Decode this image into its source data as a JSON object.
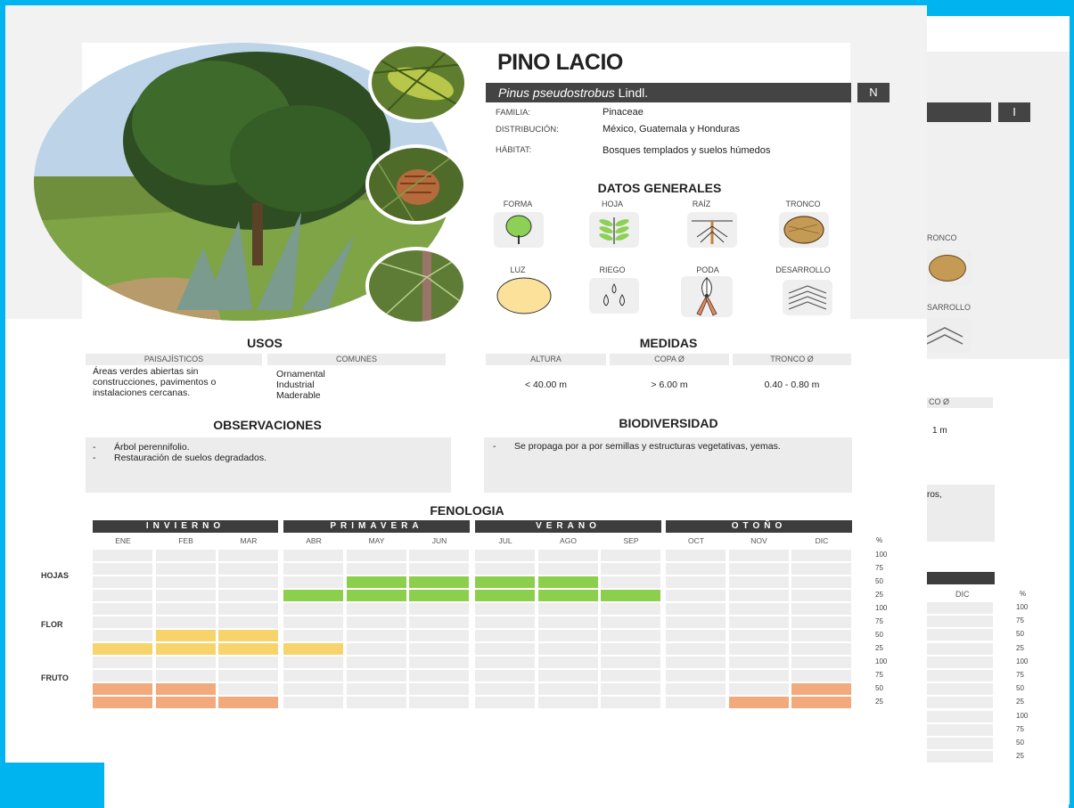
{
  "species": {
    "common_name": "PINO LACIO",
    "scientific_name": "Pinus pseudostrobus",
    "author": "Lindl.",
    "tag": "N",
    "back_tag": "I"
  },
  "info": [
    {
      "label": "FAMILIA:",
      "value": "Pinaceae"
    },
    {
      "label": "DISTRIBUCIÓN:",
      "value": "México, Guatemala y Honduras"
    },
    {
      "label": "HÁBITAT:",
      "value": "Bosques templados y suelos húmedos"
    }
  ],
  "datos_generales": {
    "title": "DATOS GENERALES",
    "items": [
      {
        "label": "FORMA",
        "icon": "tree-shape-icon"
      },
      {
        "label": "HOJA",
        "icon": "leaf-branch-icon"
      },
      {
        "label": "RAÍZ",
        "icon": "root-icon"
      },
      {
        "label": "TRONCO",
        "icon": "trunk-section-icon"
      },
      {
        "label": "LUZ",
        "icon": "light-icon"
      },
      {
        "label": "RIEGO",
        "icon": "water-drops-icon"
      },
      {
        "label": "PODA",
        "icon": "pruning-shears-icon"
      },
      {
        "label": "DESARROLLO",
        "icon": "growth-chevrons-icon"
      }
    ]
  },
  "usos": {
    "title": "USOS",
    "col1": "PAISAJÍSTICOS",
    "col2": "COMUNES",
    "text1": "Áreas verdes abiertas sin construcciones, pavimentos o instalaciones cercanas.",
    "text2_lines": [
      "Ornamental",
      "Industrial",
      "Maderable"
    ]
  },
  "medidas": {
    "title": "MEDIDAS",
    "cols": [
      "ALTURA",
      "COPA Ø",
      "TRONCO Ø"
    ],
    "values": [
      "< 40.00 m",
      "> 6.00 m",
      "0.40 - 0.80 m"
    ]
  },
  "observaciones": {
    "title": "OBSERVACIONES",
    "items": [
      "Árbol perennifolio.",
      "Restauración de suelos degradados."
    ]
  },
  "biodiversidad": {
    "title": "BIODIVERSIDAD",
    "items": [
      "Se propaga por a por semillas y estructuras vegetativas, yemas."
    ]
  },
  "fenologia": {
    "title": "FENOLOGIA",
    "seasons": [
      "INVIERNO",
      "PRIMAVERA",
      "VERANO",
      "OTOÑO"
    ],
    "months": [
      "ENE",
      "FEB",
      "MAR",
      "ABR",
      "MAY",
      "JUN",
      "JUL",
      "AGO",
      "SEP",
      "OCT",
      "NOV",
      "DIC"
    ],
    "pct_header": "%",
    "pct_levels": [
      "100",
      "75",
      "50",
      "25"
    ],
    "rows": [
      {
        "name": "HOJAS",
        "color": "#8ccf4d",
        "levels": [
          0,
          0,
          0,
          1,
          2,
          2,
          2,
          2,
          1,
          0,
          0,
          0
        ]
      },
      {
        "name": "FLOR",
        "color": "#f7d46b",
        "levels": [
          1,
          2,
          2,
          1,
          0,
          0,
          0,
          0,
          0,
          0,
          0,
          0
        ]
      },
      {
        "name": "FRUTO",
        "color": "#f2a97c",
        "levels": [
          2,
          2,
          1,
          0,
          0,
          0,
          0,
          0,
          0,
          0,
          1,
          2
        ]
      }
    ]
  },
  "back_sheet": {
    "labels": [
      "RONCO",
      "SARROLLO",
      "CO Ø",
      "1 m",
      "ros,",
      "DIC",
      "%"
    ],
    "pct_levels": [
      "100",
      "75",
      "50",
      "25",
      "100",
      "75",
      "50",
      "25",
      "100",
      "75",
      "50",
      "25"
    ]
  }
}
